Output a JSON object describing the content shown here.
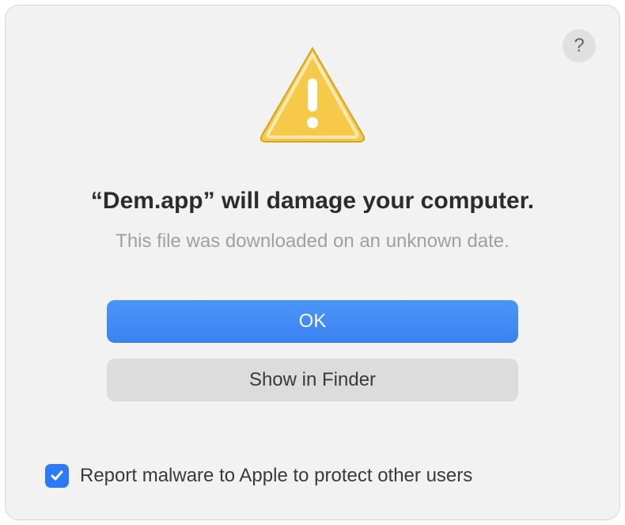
{
  "dialog": {
    "title": "“Dem.app” will damage your computer.",
    "subtitle": "This file was downloaded on an unknown date.",
    "buttons": {
      "primary": "OK",
      "secondary": "Show in Finder"
    },
    "checkbox": {
      "checked": true,
      "label": "Report malware to Apple to protect other users"
    },
    "help_tooltip": "?"
  },
  "icons": {
    "warning": "warning-triangle-icon",
    "help": "help-icon",
    "checkmark": "checkmark-icon"
  }
}
